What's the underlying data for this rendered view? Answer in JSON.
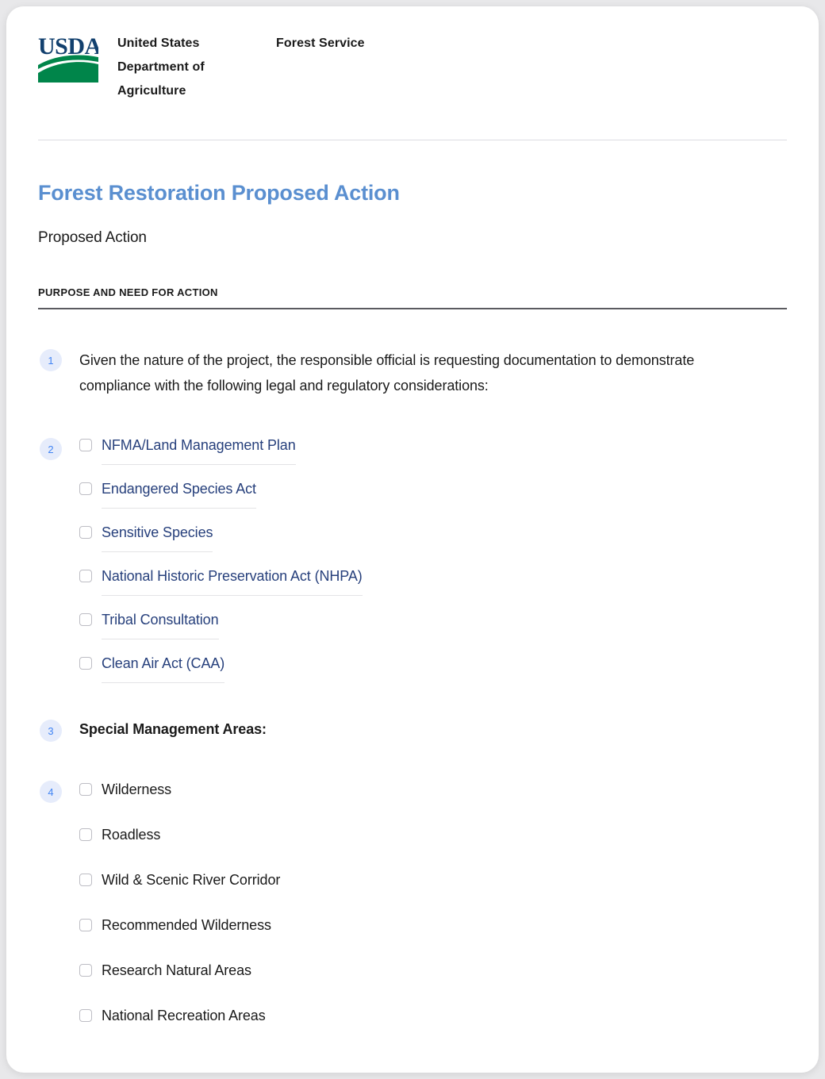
{
  "header": {
    "logo_alt": "USDA",
    "logo_text": "USDA",
    "agency": "United States Department of Agriculture",
    "service": "Forest Service"
  },
  "document": {
    "title": "Forest Restoration Proposed Action",
    "subtitle": "Proposed Action",
    "section_label": "PURPOSE AND NEED FOR ACTION"
  },
  "blocks": [
    {
      "number": "1",
      "text": "Given the nature of the project, the responsible official is requesting documentation to demonstrate compliance with the following legal and regulatory considerations:"
    },
    {
      "number": "3",
      "text": "Special Management Areas:"
    }
  ],
  "compliance_list": {
    "number": "2",
    "items": [
      {
        "label": "NFMA/Land Management Plan",
        "checked": false
      },
      {
        "label": "Endangered Species Act",
        "checked": false
      },
      {
        "label": "Sensitive Species",
        "checked": false
      },
      {
        "label": "National Historic Preservation Act (NHPA)",
        "checked": false
      },
      {
        "label": "Tribal Consultation",
        "checked": false
      },
      {
        "label": "Clean Air Act (CAA)",
        "checked": false
      }
    ]
  },
  "special_areas_list": {
    "number": "4",
    "items": [
      {
        "label": "Wilderness",
        "checked": false
      },
      {
        "label": "Roadless",
        "checked": false
      },
      {
        "label": "Wild & Scenic River Corridor",
        "checked": false
      },
      {
        "label": "Recommended Wilderness",
        "checked": false
      },
      {
        "label": "Research Natural Areas",
        "checked": false
      },
      {
        "label": "National Recreation Areas",
        "checked": false
      }
    ]
  },
  "colors": {
    "title_blue": "#5a8fd0",
    "link_blue": "#27407c",
    "badge_bg": "#e6ecfb",
    "badge_text": "#4285f4",
    "logo_blue": "#12406e",
    "logo_green": "#00854a",
    "rule_dark": "#5b5b60",
    "rule_light": "#dcdce2"
  }
}
